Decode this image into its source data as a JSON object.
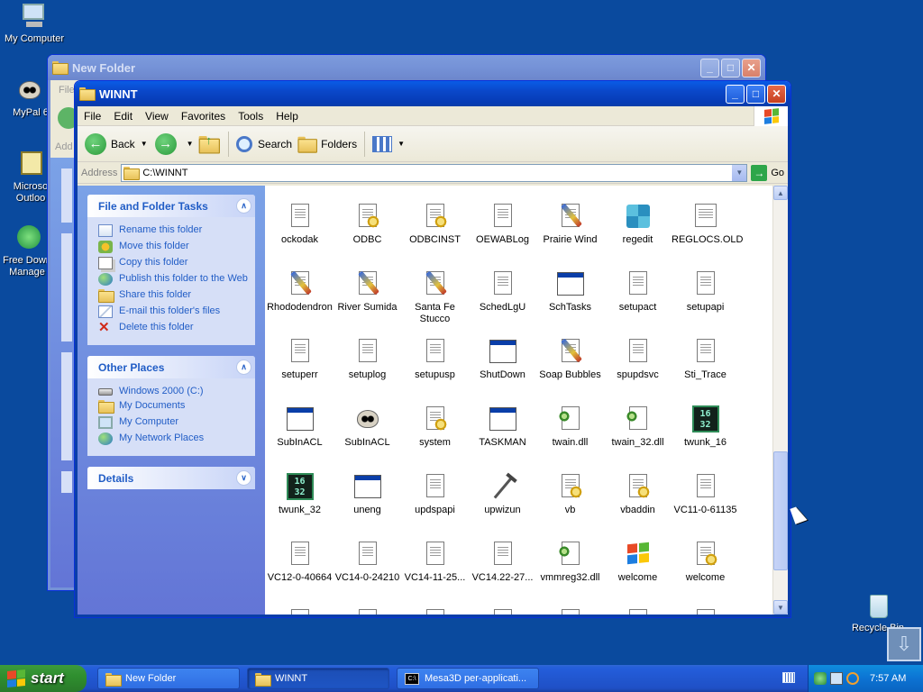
{
  "desktop": {
    "icons": [
      {
        "label": "My Computer"
      },
      {
        "label": "MyPal 6"
      },
      {
        "label": "Microso\nOutloo"
      },
      {
        "label": "Free Down\nManage"
      },
      {
        "label": "Recycle Bin"
      }
    ]
  },
  "window_back": {
    "title": "New Folder",
    "menu_fragment": "File",
    "address_fragment": "Add"
  },
  "window": {
    "title": "WINNT",
    "menu": [
      "File",
      "Edit",
      "View",
      "Favorites",
      "Tools",
      "Help"
    ],
    "toolbar": {
      "back": "Back",
      "search": "Search",
      "folders": "Folders"
    },
    "address": {
      "label": "Address",
      "value": "C:\\WINNT",
      "go": "Go"
    },
    "taskpane": {
      "file_tasks": {
        "title": "File and Folder Tasks",
        "items": [
          {
            "label": "Rename this folder"
          },
          {
            "label": "Move this folder"
          },
          {
            "label": "Copy this folder"
          },
          {
            "label": "Publish this folder to the Web"
          },
          {
            "label": "Share this folder"
          },
          {
            "label": "E-mail this folder's files"
          },
          {
            "label": "Delete this folder"
          }
        ]
      },
      "other_places": {
        "title": "Other Places",
        "items": [
          {
            "label": "Windows 2000 (C:)"
          },
          {
            "label": "My Documents"
          },
          {
            "label": "My Computer"
          },
          {
            "label": "My Network Places"
          }
        ]
      },
      "details": {
        "title": "Details"
      }
    },
    "files": [
      {
        "name": "ockodak",
        "icon": "text-file"
      },
      {
        "name": "ODBC",
        "icon": "settings-file"
      },
      {
        "name": "ODBCINST",
        "icon": "settings-file"
      },
      {
        "name": "OEWABLog",
        "icon": "text-file"
      },
      {
        "name": "Prairie Wind",
        "icon": "paint-brush"
      },
      {
        "name": "regedit",
        "icon": "registry-cubes"
      },
      {
        "name": "REGLOCS.OLD",
        "icon": "old-file"
      },
      {
        "name": "Rhododendron",
        "icon": "paint-brush"
      },
      {
        "name": "River Sumida",
        "icon": "paint-brush"
      },
      {
        "name": "Santa Fe Stucco",
        "icon": "paint-brush"
      },
      {
        "name": "SchedLgU",
        "icon": "text-file"
      },
      {
        "name": "SchTasks",
        "icon": "app-window"
      },
      {
        "name": "setupact",
        "icon": "text-file"
      },
      {
        "name": "setupapi",
        "icon": "text-file"
      },
      {
        "name": "setuperr",
        "icon": "text-file"
      },
      {
        "name": "setuplog",
        "icon": "text-file"
      },
      {
        "name": "setupusp",
        "icon": "text-file"
      },
      {
        "name": "ShutDown",
        "icon": "app-window"
      },
      {
        "name": "Soap Bubbles",
        "icon": "paint-brush"
      },
      {
        "name": "spupdsvc",
        "icon": "text-file"
      },
      {
        "name": "Sti_Trace",
        "icon": "text-file"
      },
      {
        "name": "SubInACL",
        "icon": "app-window"
      },
      {
        "name": "SubInACL",
        "icon": "raccoon"
      },
      {
        "name": "system",
        "icon": "settings-file"
      },
      {
        "name": "TASKMAN",
        "icon": "app-window"
      },
      {
        "name": "twain.dll",
        "icon": "dll-file"
      },
      {
        "name": "twain_32.dll",
        "icon": "dll-file"
      },
      {
        "name": "twunk_16",
        "icon": "win16-app"
      },
      {
        "name": "twunk_32",
        "icon": "win16-app"
      },
      {
        "name": "uneng",
        "icon": "app-window"
      },
      {
        "name": "updspapi",
        "icon": "text-file"
      },
      {
        "name": "upwizun",
        "icon": "hammer"
      },
      {
        "name": "vb",
        "icon": "settings-file"
      },
      {
        "name": "vbaddin",
        "icon": "settings-file"
      },
      {
        "name": "VC11-0-61135",
        "icon": "text-file"
      },
      {
        "name": "VC12-0-40664",
        "icon": "text-file"
      },
      {
        "name": "VC14-0-24210",
        "icon": "text-file"
      },
      {
        "name": "VC14-11-25...",
        "icon": "text-file"
      },
      {
        "name": "VC14.22-27...",
        "icon": "text-file"
      },
      {
        "name": "vmmreg32.dll",
        "icon": "dll-file"
      },
      {
        "name": "welcome",
        "icon": "windows-flag"
      },
      {
        "name": "welcome",
        "icon": "settings-file"
      }
    ]
  },
  "taskbar": {
    "start": "start",
    "tasks": [
      {
        "label": "New Folder"
      },
      {
        "label": "WINNT"
      },
      {
        "label": "Mesa3D per-applicati..."
      }
    ],
    "clock": "7:57 AM"
  }
}
